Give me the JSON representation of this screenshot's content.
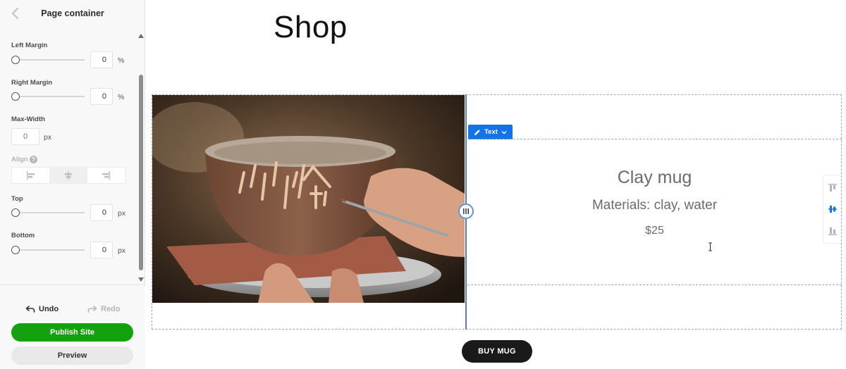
{
  "panel": {
    "title": "Page container",
    "fields": {
      "left_margin": {
        "label": "Left Margin",
        "value": "0",
        "unit": "%",
        "slider_value": 0
      },
      "right_margin": {
        "label": "Right Margin",
        "value": "0",
        "unit": "%",
        "slider_value": 0
      },
      "max_width": {
        "label": "Max-Width",
        "placeholder": "0",
        "unit": "px"
      },
      "align": {
        "label": "Align",
        "help_icon": "?",
        "options": [
          "align-left",
          "align-center",
          "align-right"
        ],
        "selected": "align-center"
      },
      "top": {
        "label": "Top",
        "value": "0",
        "unit": "px",
        "slider_value": 0
      },
      "bottom": {
        "label": "Bottom",
        "value": "0",
        "unit": "px",
        "slider_value": 0
      }
    },
    "footer": {
      "undo_label": "Undo",
      "redo_label": "Redo",
      "publish_label": "Publish Site",
      "preview_label": "Preview"
    }
  },
  "canvas": {
    "page_title": "Shop",
    "text_chip_label": "Text",
    "product": {
      "name": "Clay mug",
      "materials": "Materials: clay, water",
      "price": "$25"
    },
    "buy_button_label": "BUY MUG"
  },
  "colors": {
    "publish": "#13a10e",
    "selection": "#1473e6",
    "buy_button": "#1a1a1a"
  }
}
